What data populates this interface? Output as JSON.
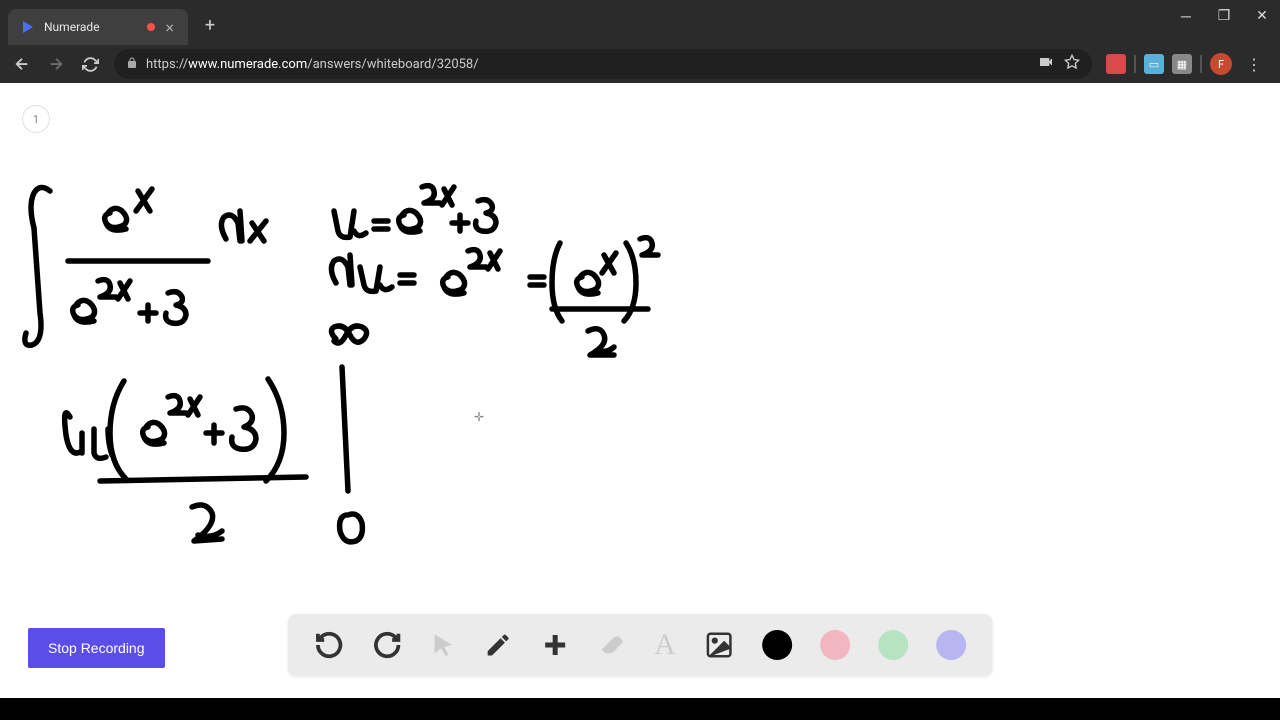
{
  "tab": {
    "title": "Numerade",
    "favicon_color": "#4a6ef5"
  },
  "url": {
    "protocol": "https://",
    "domain": "www.numerade.com",
    "path": "/answers/whiteboard/32058/"
  },
  "avatar_letter": "F",
  "page_number": "1",
  "stop_recording_label": "Stop Recording",
  "toolbar": {
    "undo": "↶",
    "redo": "↷",
    "cursor": "cursor",
    "pen": "pen",
    "plus": "+",
    "eraser": "eraser",
    "text": "A",
    "image": "image"
  }
}
